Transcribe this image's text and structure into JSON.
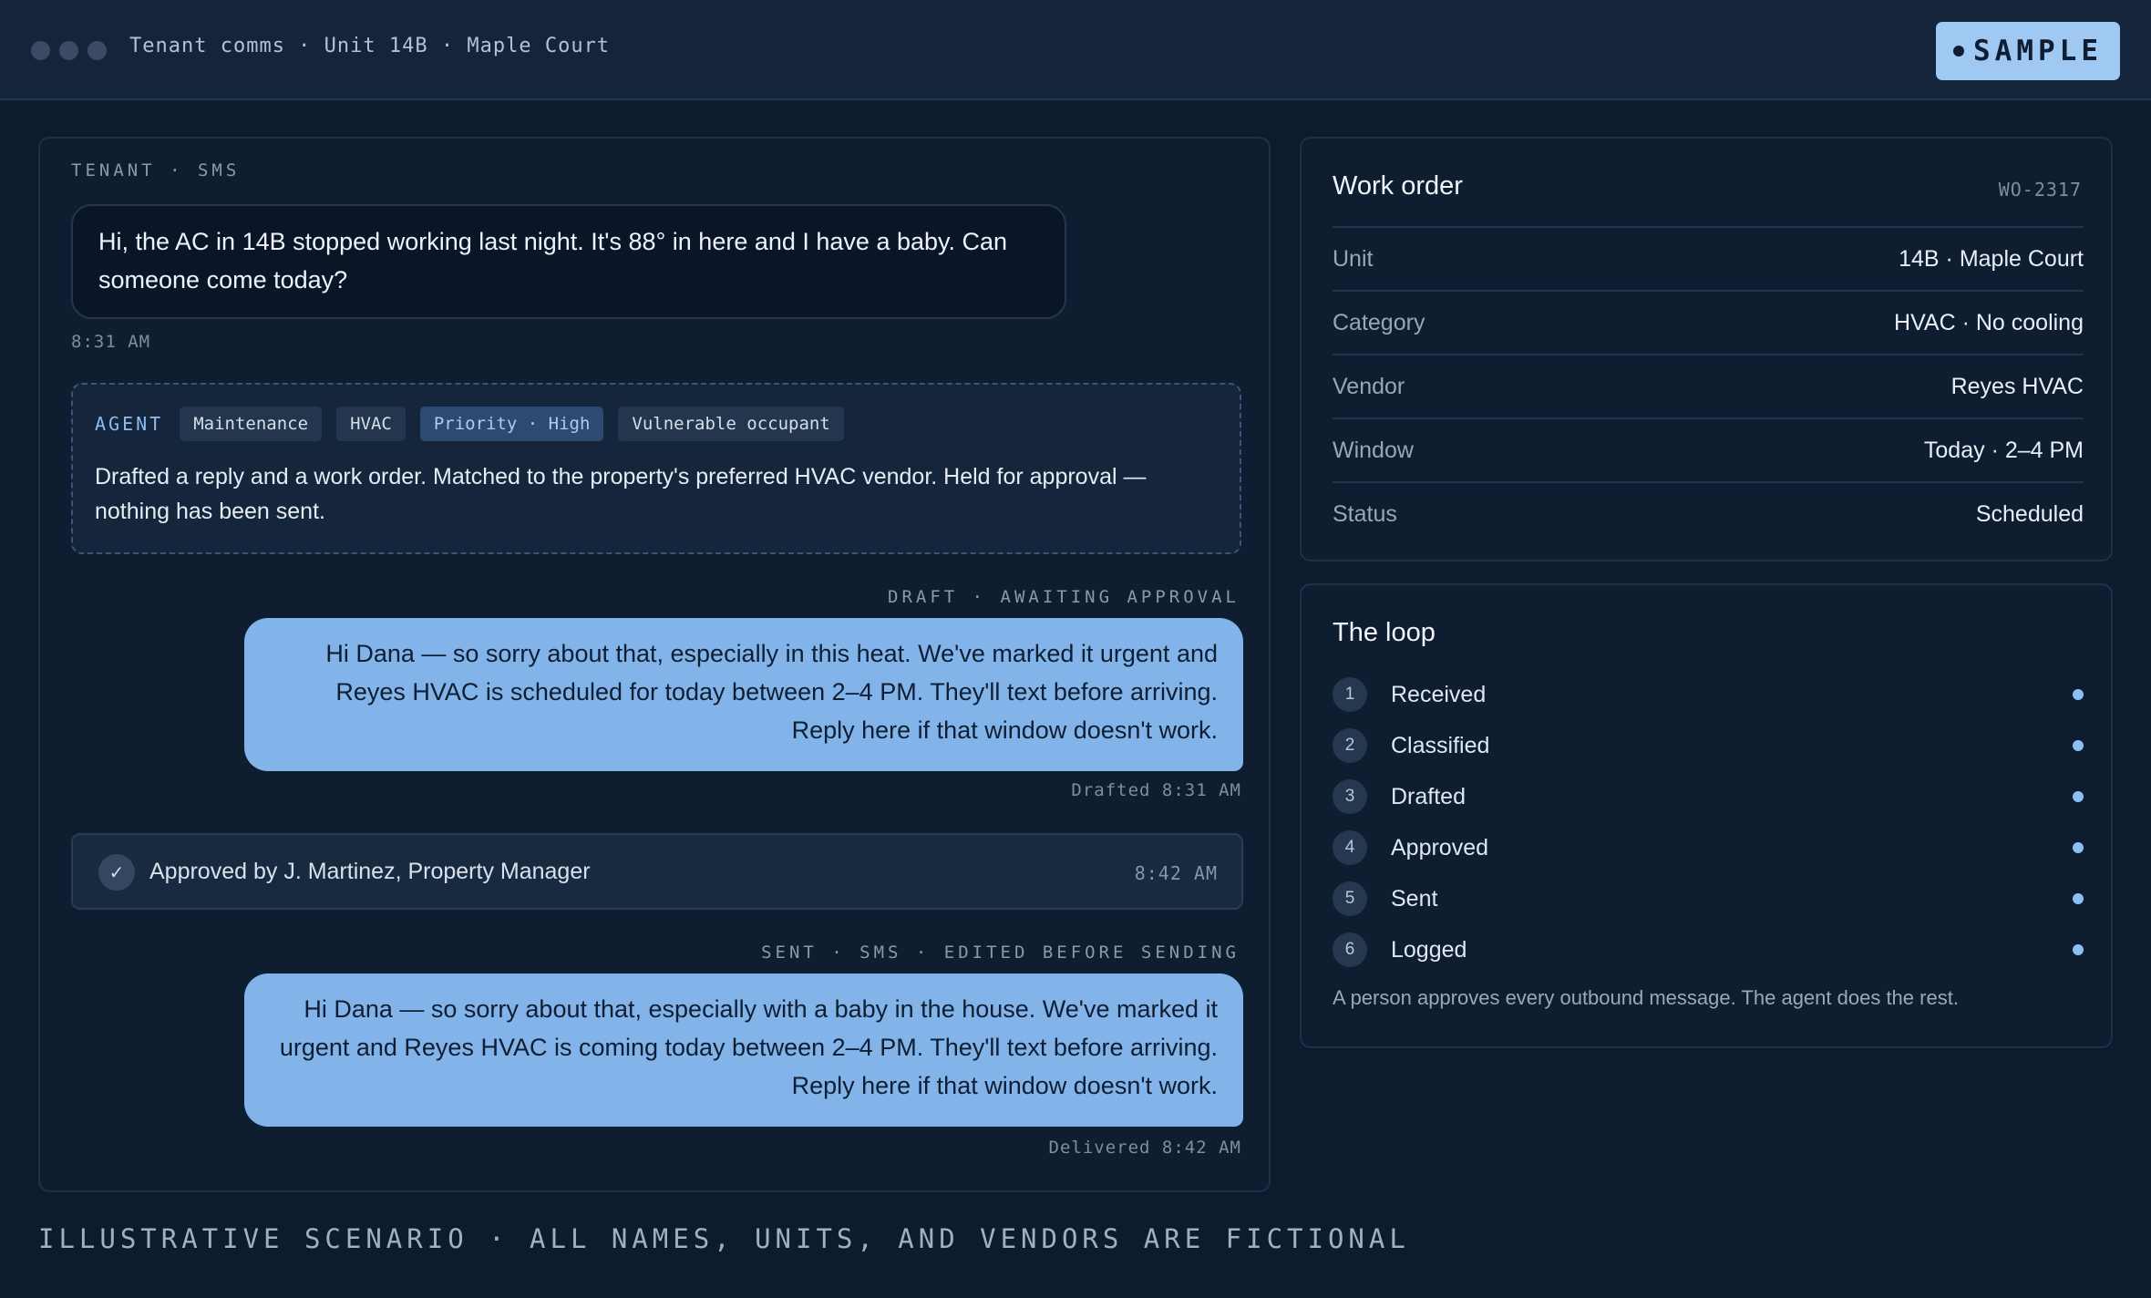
{
  "window": {
    "title": "Tenant comms · Unit 14B · Maple Court",
    "badge": "SAMPLE"
  },
  "conversation": {
    "tenant_label": "TENANT · SMS",
    "tenant_message": "Hi, the AC in 14B stopped working last night. It's 88° in here and I have a baby. Can someone come today?",
    "tenant_time": "8:31 AM",
    "agent": {
      "label": "AGENT",
      "tags": [
        "Maintenance",
        "HVAC",
        "Priority · High",
        "Vulnerable occupant"
      ],
      "summary": "Drafted a reply and a work order. Matched to the property's preferred HVAC vendor. Held for approval — nothing has been sent."
    },
    "draft": {
      "label": "DRAFT · AWAITING APPROVAL",
      "message": "Hi Dana — so sorry about that, especially in this heat. We've marked it urgent and Reyes HVAC is scheduled for today between 2–4 PM. They'll text before arriving. Reply here if that window doesn't work.",
      "time": "Drafted 8:31 AM"
    },
    "approval": {
      "text": "Approved by J. Martinez, Property Manager",
      "time": "8:42 AM"
    },
    "sent": {
      "label": "SENT · SMS · EDITED BEFORE SENDING",
      "message": "Hi Dana — so sorry about that, especially with a baby in the house. We've marked it urgent and Reyes HVAC is coming today between 2–4 PM. They'll text before arriving. Reply here if that window doesn't work.",
      "time": "Delivered 8:42 AM"
    }
  },
  "footer_note": "ILLUSTRATIVE SCENARIO · ALL NAMES, UNITS, AND VENDORS ARE FICTIONAL",
  "work_order": {
    "title": "Work order",
    "id": "WO-2317",
    "rows": [
      {
        "key": "Unit",
        "value": "14B · Maple Court"
      },
      {
        "key": "Category",
        "value": "HVAC · No cooling"
      },
      {
        "key": "Vendor",
        "value": "Reyes HVAC"
      },
      {
        "key": "Window",
        "value": "Today · 2–4 PM"
      },
      {
        "key": "Status",
        "value": "Scheduled"
      }
    ]
  },
  "loop": {
    "title": "The loop",
    "steps": [
      {
        "num": "1",
        "label": "Received"
      },
      {
        "num": "2",
        "label": "Classified"
      },
      {
        "num": "3",
        "label": "Drafted"
      },
      {
        "num": "4",
        "label": "Approved"
      },
      {
        "num": "5",
        "label": "Sent"
      },
      {
        "num": "6",
        "label": "Logged"
      }
    ],
    "note": "A person approves every outbound message. The agent does the rest."
  },
  "colors": {
    "background": "#0d1b2e",
    "accent": "#82b4ea",
    "badge": "#9fc8f3"
  }
}
